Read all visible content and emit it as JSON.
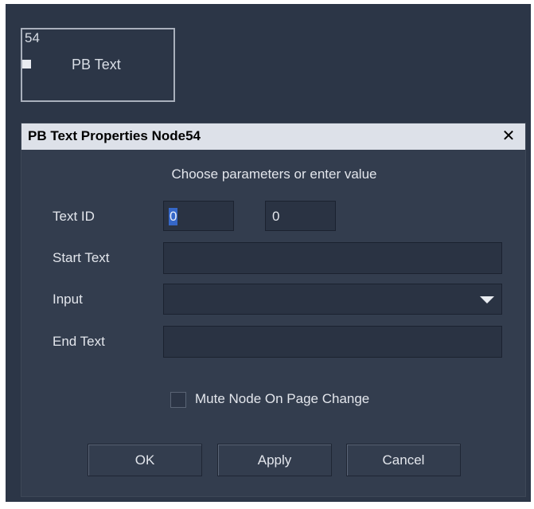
{
  "node": {
    "id": "54",
    "label": "PB Text"
  },
  "dialog": {
    "title": "PB Text Properties Node54",
    "close_glyph": "✕",
    "subtitle": "Choose parameters or enter value",
    "fields": {
      "text_id_label": "Text ID",
      "text_id_value_1": "0",
      "text_id_value_2": "0",
      "start_text_label": "Start Text",
      "start_text_value": "",
      "input_label": "Input",
      "input_value": "",
      "end_text_label": "End Text",
      "end_text_value": ""
    },
    "mute_checkbox": {
      "label": "Mute Node On Page Change",
      "checked": false
    },
    "buttons": {
      "ok": "OK",
      "apply": "Apply",
      "cancel": "Cancel"
    }
  },
  "colors": {
    "canvas_bg": "#2c3647",
    "dialog_bg": "#333d4e",
    "titlebar_bg": "#dde1e9",
    "field_bg": "#2a3343",
    "selection": "#3567c8"
  }
}
